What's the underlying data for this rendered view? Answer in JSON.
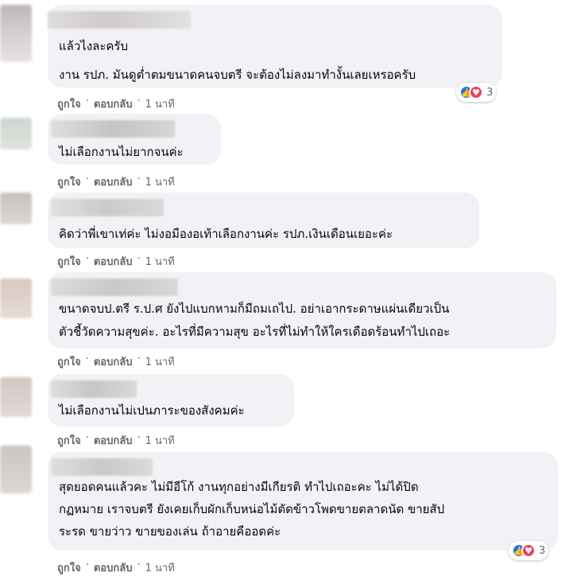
{
  "labels": {
    "like": "ถูกใจ",
    "reply": "ตอบกลับ",
    "separator": "·"
  },
  "colors": {
    "bubble": "#f0f2f5",
    "meta": "#65676b",
    "like": "#1877f2",
    "love": "#f33e58"
  },
  "comments": [
    {
      "lines": [
        "แล้วไงละครับ",
        "งาน รปภ. มันดูต่ำตมขนาดคนจบตรี จะต้องไม่ลงมาทำงั้นเลยเหรอครับ"
      ],
      "time": "1 นาที",
      "reactions": {
        "types": [
          "like-icon",
          "love-icon"
        ],
        "count": "3"
      }
    },
    {
      "lines": [
        "ไม่เลือกงานไม่ยากจนค่ะ"
      ],
      "time": "1 นาที"
    },
    {
      "lines": [
        "คิดว่าพี่เขาเท่ค่ะ ไม่งอมืองอเท้าเลือกงานค่ะ รปภ.เงินเดือนเยอะค่ะ"
      ],
      "time": "1 นาที"
    },
    {
      "lines": [
        "ขนาดจบป.ตรี ร.ป.ศ ยังไปแบกหามก็มีถมเถไป. อย่าเอากระดาษแผ่นเดียวเป็น",
        "ตัวชี้วัดความสุขค่ะ. อะไรที่มีความสุข อะไรที่ไม่ทำให้ใครเดือดร้อนทำไปเถอะ"
      ],
      "time": "1 นาที"
    },
    {
      "lines": [
        "ไม่เลือกงานไม่เปนภาระของสังคมค่ะ"
      ],
      "time": "1 นาที"
    },
    {
      "lines": [
        "สุดยอดคนแล้วคะ ไม่มีอีโก้ งานทุกอย่างมีเกียรติ ทำไปเถอะคะ ไม่ได้ปิด",
        "กฏหมาย เราจบตรี ยังเคยเก็บผักเก็บหน่อไม้ตัดข้าวโพดขายตลาดนัด ขายสัป",
        "ระรด ขายว่าว ขายของเล่น ถ้าอายคืออดค่ะ"
      ],
      "time": "1 นาที",
      "reactions": {
        "types": [
          "like-icon",
          "love-icon"
        ],
        "count": "3"
      }
    }
  ]
}
